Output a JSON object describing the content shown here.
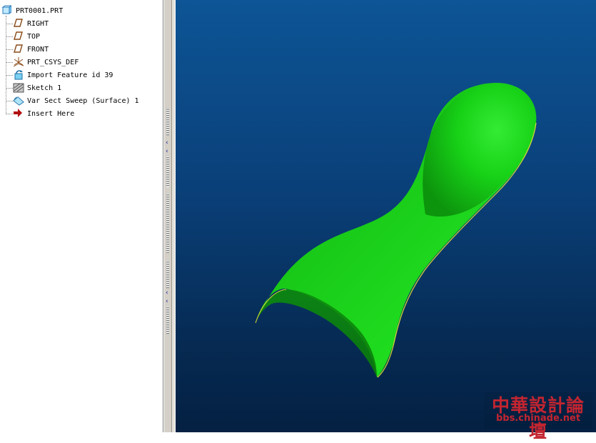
{
  "model_tree": {
    "root_label": "PRT0001.PRT",
    "items": [
      {
        "label": "RIGHT",
        "icon": "datum-plane-icon"
      },
      {
        "label": "TOP",
        "icon": "datum-plane-icon"
      },
      {
        "label": "FRONT",
        "icon": "datum-plane-icon"
      },
      {
        "label": "PRT_CSYS_DEF",
        "icon": "coordinate-system-icon"
      },
      {
        "label": "Import Feature id 39",
        "icon": "import-feature-icon"
      },
      {
        "label": "Sketch 1",
        "icon": "sketch-icon"
      },
      {
        "label": "Var Sect Sweep (Surface) 1",
        "icon": "sweep-surface-icon"
      },
      {
        "label": "Insert Here",
        "icon": "insert-here-arrow-icon"
      }
    ]
  },
  "viewport": {
    "background_top": "#0d5596",
    "background_bottom": "#042042",
    "model_color": "#19c219",
    "edge_color": "#d8d838"
  },
  "watermark": {
    "title": "中華設計論壇",
    "url": "bbs.chinade.net",
    "color": "#c32530"
  }
}
